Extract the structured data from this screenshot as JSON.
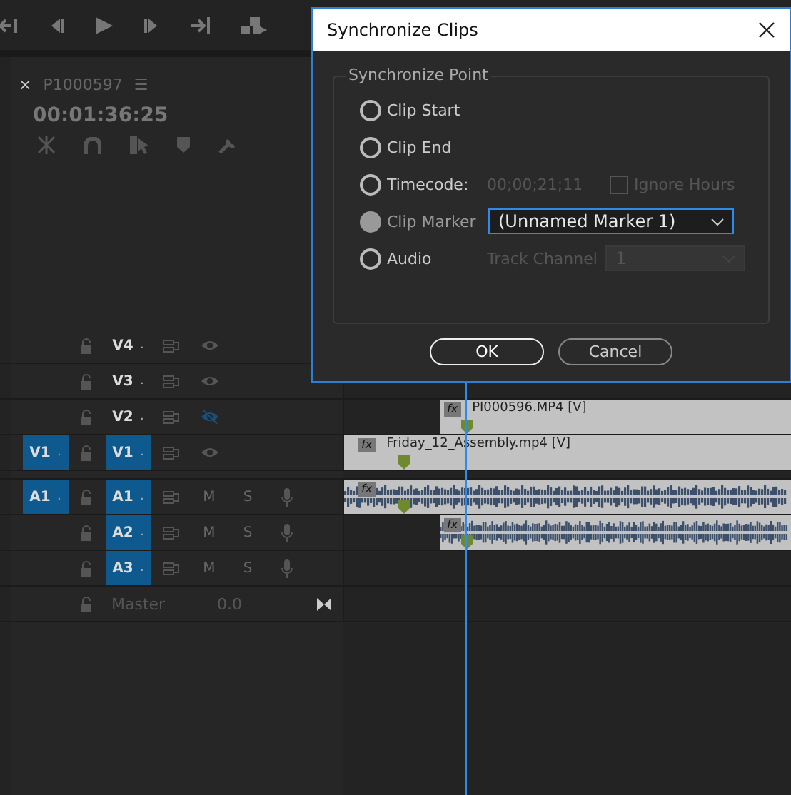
{
  "panel": {
    "tab": {
      "close": "×",
      "title": "P1000597",
      "menu": "☰"
    },
    "timecode": "00:01:36:25"
  },
  "tracks": [
    {
      "kind": "video",
      "name": "V4",
      "dot": ".",
      "targeted": false,
      "visible": true
    },
    {
      "kind": "video",
      "name": "V3",
      "dot": ".",
      "targeted": false,
      "visible": true
    },
    {
      "kind": "video",
      "name": "V2",
      "dot": ".",
      "targeted": false,
      "visible": false,
      "clip": {
        "kind": "video",
        "badge": "fx",
        "name": "PI000596.MP4 [V]",
        "aligned": false
      }
    },
    {
      "kind": "video",
      "name": "V1",
      "dot": ".",
      "source": "V1",
      "source_dot": ".",
      "targeted": true,
      "visible": true,
      "clip": {
        "kind": "video",
        "badge": "fx",
        "name": "Friday_12_Assembly.mp4 [V]",
        "aligned": true
      }
    },
    {
      "kind": "audio",
      "name": "A1",
      "dot": ".",
      "source": "A1",
      "source_dot": ".",
      "targeted": true,
      "mute": "M",
      "solo": "S",
      "clip": {
        "kind": "audio",
        "badge": "fx",
        "aligned": true
      }
    },
    {
      "kind": "audio",
      "name": "A2",
      "dot": ".",
      "targeted": true,
      "mute": "M",
      "solo": "S",
      "clip": {
        "kind": "audio",
        "badge": "fx",
        "aligned": false
      }
    },
    {
      "kind": "audio",
      "name": "A3",
      "dot": ".",
      "targeted": true,
      "mute": "M",
      "solo": "S"
    },
    {
      "kind": "master",
      "name": "Master",
      "volume": "0.0"
    }
  ],
  "dialog": {
    "title": "Synchronize Clips",
    "group": "Synchronize Point",
    "options": [
      {
        "kind": "plain",
        "label": "Clip Start",
        "selected": false
      },
      {
        "kind": "plain",
        "label": "Clip End",
        "selected": false
      },
      {
        "kind": "timecode",
        "label": "Timecode:",
        "selected": false,
        "value": "00;00;21;11",
        "disabled": true,
        "checkbox": {
          "label": "Ignore Hours",
          "checked": false,
          "disabled": true
        }
      },
      {
        "kind": "select",
        "label": "Clip Marker",
        "selected": true,
        "value": "(Unnamed Marker 1)",
        "disabled": false
      },
      {
        "kind": "audio",
        "label": "Audio",
        "selected": false,
        "field_label": "Track Channel",
        "value": "1",
        "disabled": true
      }
    ],
    "buttons": [
      {
        "label": "OK",
        "default": true
      },
      {
        "label": "Cancel",
        "default": false
      }
    ]
  }
}
